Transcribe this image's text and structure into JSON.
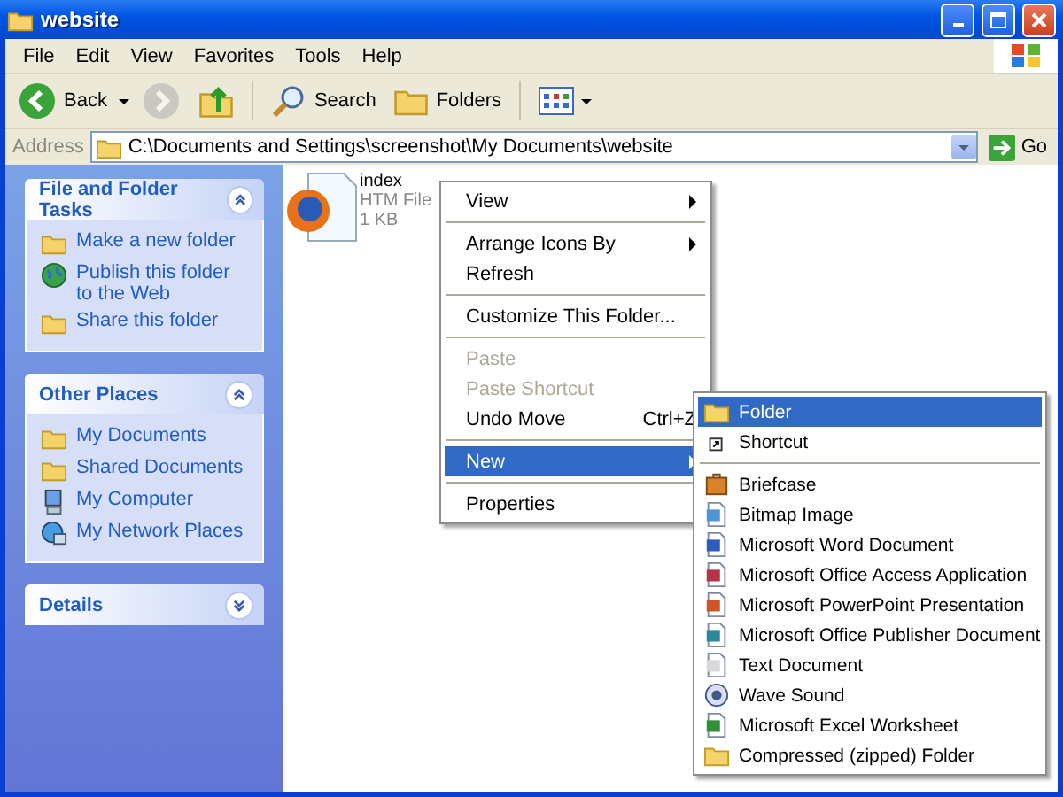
{
  "window": {
    "title": "website"
  },
  "menu_bar": [
    "File",
    "Edit",
    "View",
    "Favorites",
    "Tools",
    "Help"
  ],
  "toolbar": {
    "back": {
      "label": "Back",
      "disabled": false
    },
    "forward": {
      "disabled": true
    },
    "search": {
      "label": "Search"
    },
    "folders": {
      "label": "Folders"
    }
  },
  "address_bar": {
    "label": "Address",
    "value": "C:\\Documents and Settings\\screenshot\\My Documents\\website",
    "go": "Go"
  },
  "sidebar": {
    "panels": [
      {
        "title": "File and Folder Tasks",
        "expanded": true,
        "items": [
          {
            "label": "Make a new folder",
            "kind": "newfolder"
          },
          {
            "label": "Publish this folder to the Web",
            "kind": "globe"
          },
          {
            "label": "Share this folder",
            "kind": "share"
          }
        ]
      },
      {
        "title": "Other Places",
        "expanded": true,
        "items": [
          {
            "label": "My Documents",
            "kind": "mydocs"
          },
          {
            "label": "Shared Documents",
            "kind": "folder"
          },
          {
            "label": "My Computer",
            "kind": "computer"
          },
          {
            "label": "My Network Places",
            "kind": "network"
          }
        ]
      },
      {
        "title": "Details",
        "expanded": false
      }
    ]
  },
  "files": [
    {
      "name": "index",
      "type": "HTM File",
      "size": "1 KB"
    }
  ],
  "context_menu": {
    "items": [
      {
        "kind": "item",
        "label": "View",
        "submenu": true,
        "selected": false,
        "disabled": false
      },
      {
        "kind": "separator"
      },
      {
        "kind": "item",
        "label": "Arrange Icons By",
        "submenu": true,
        "selected": false,
        "disabled": false
      },
      {
        "kind": "item",
        "label": "Refresh",
        "submenu": false,
        "selected": false,
        "disabled": false
      },
      {
        "kind": "separator"
      },
      {
        "kind": "item",
        "label": "Customize This Folder...",
        "submenu": false,
        "selected": false,
        "disabled": false
      },
      {
        "kind": "separator"
      },
      {
        "kind": "item",
        "label": "Paste",
        "submenu": false,
        "selected": false,
        "disabled": true
      },
      {
        "kind": "item",
        "label": "Paste Shortcut",
        "submenu": false,
        "selected": false,
        "disabled": true
      },
      {
        "kind": "item",
        "label": "Undo Move",
        "shortcut": "Ctrl+Z",
        "submenu": false,
        "selected": false,
        "disabled": false
      },
      {
        "kind": "separator"
      },
      {
        "kind": "item",
        "label": "New",
        "submenu": true,
        "selected": true,
        "disabled": false
      },
      {
        "kind": "separator"
      },
      {
        "kind": "item",
        "label": "Properties",
        "submenu": false,
        "selected": false,
        "disabled": false
      }
    ]
  },
  "new_submenu": {
    "items": [
      {
        "kind": "folder",
        "label": "Folder",
        "selected": true
      },
      {
        "kind": "shortcut",
        "label": "Shortcut",
        "selected": false
      },
      {
        "kind": "separator"
      },
      {
        "kind": "briefcase",
        "label": "Briefcase",
        "selected": false
      },
      {
        "kind": "bitmap",
        "label": "Bitmap Image",
        "selected": false
      },
      {
        "kind": "word",
        "label": "Microsoft Word Document",
        "selected": false
      },
      {
        "kind": "access",
        "label": "Microsoft Office Access Application",
        "selected": false
      },
      {
        "kind": "powerpoint",
        "label": "Microsoft PowerPoint Presentation",
        "selected": false
      },
      {
        "kind": "publisher",
        "label": "Microsoft Office Publisher Document",
        "selected": false
      },
      {
        "kind": "text",
        "label": "Text Document",
        "selected": false
      },
      {
        "kind": "wave",
        "label": "Wave Sound",
        "selected": false
      },
      {
        "kind": "excel",
        "label": "Microsoft Excel Worksheet",
        "selected": false
      },
      {
        "kind": "zip",
        "label": "Compressed (zipped) Folder",
        "selected": false
      }
    ]
  }
}
